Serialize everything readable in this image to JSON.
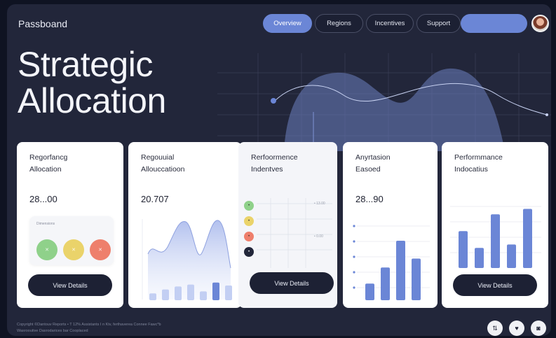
{
  "brand": "Passboand",
  "nav": {
    "items": [
      {
        "label": "Overview",
        "active": true
      },
      {
        "label": "Regions",
        "active": false
      },
      {
        "label": "Incentives",
        "active": false
      },
      {
        "label": "Support",
        "active": false
      }
    ],
    "cta_label": ""
  },
  "hero": {
    "title_line1": "Strategic",
    "title_line2": "Allocation"
  },
  "cards": [
    {
      "title": "Regorfancg\nAllocation",
      "value": "28...00",
      "panel_label": "Dimensions",
      "status_dots": [
        {
          "glyph": "✕",
          "color": "#8fd18a"
        },
        {
          "glyph": "✕",
          "color": "#ead36a"
        },
        {
          "glyph": "✕",
          "color": "#ee7f6c"
        }
      ],
      "button": "View Details"
    },
    {
      "title": "Regouuial\nAllouccatioon",
      "value": "20.707",
      "bars": [
        0.35,
        0.55,
        0.7,
        0.8,
        0.45,
        0.9,
        0.75
      ]
    },
    {
      "title": "Rerfoormence\nIndentves",
      "legend": [
        {
          "glyph": "•",
          "color": "#8fd18a"
        },
        {
          "glyph": "•",
          "color": "#ead36a"
        },
        {
          "glyph": "•",
          "color": "#ee7f6c"
        },
        {
          "glyph": "•",
          "color": "#22263a"
        }
      ],
      "tick_labels": [
        "• 13.00",
        "• 0.00"
      ],
      "button": "View Details"
    },
    {
      "title": "Anyrtasion\nEasoed",
      "value": "28...90",
      "bars": [
        0.28,
        0.55,
        1.0,
        0.7
      ]
    },
    {
      "title": "Performmance\nIndocatius",
      "bars": [
        0.55,
        0.3,
        0.8,
        0.35,
        0.88
      ],
      "button": "View Details"
    }
  ],
  "footer": {
    "line1": "Copyright ©Dantouv Reports • T 12% Assistants I n Ktv, ferthaverea Connee Fawc*b",
    "line2": "Wasrooutive Dasrodarices bar Cooplaced"
  },
  "social_icons": [
    "link-icon",
    "twitter-icon",
    "instagram-icon"
  ],
  "colors": {
    "accent": "#6b86d6",
    "background": "#22263a",
    "card": "#ffffff",
    "dark_button": "#1d2134"
  }
}
